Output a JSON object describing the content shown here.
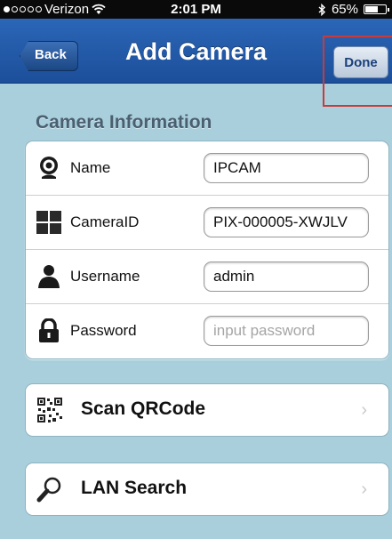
{
  "status": {
    "carrier": "Verizon",
    "time": "2:01 PM",
    "battery": "65%",
    "battery_level": 0.65,
    "icons": [
      "wifi-icon",
      "bluetooth-icon",
      "battery-icon"
    ]
  },
  "nav": {
    "title": "Add Camera",
    "back_label": "Back",
    "done_label": "Done"
  },
  "section": {
    "title": "Camera Information"
  },
  "fields": [
    {
      "label": "Name",
      "value": "IPCAM",
      "icon": "webcam-icon"
    },
    {
      "label": "CameraID",
      "value": "PIX-000005-XWJLV",
      "icon": "grid-icon"
    },
    {
      "label": "Username",
      "value": "admin",
      "icon": "user-icon"
    },
    {
      "label": "Password",
      "value": "",
      "placeholder": "input password",
      "icon": "lock-icon"
    }
  ],
  "actions": {
    "scan": {
      "label": "Scan QRCode",
      "icon": "qrcode-icon"
    },
    "lan": {
      "label": "LAN Search",
      "icon": "magnifier-icon"
    }
  },
  "colors": {
    "nav": "#2b66b7",
    "background": "#a9cfdd",
    "highlight": "#c83b3b"
  }
}
